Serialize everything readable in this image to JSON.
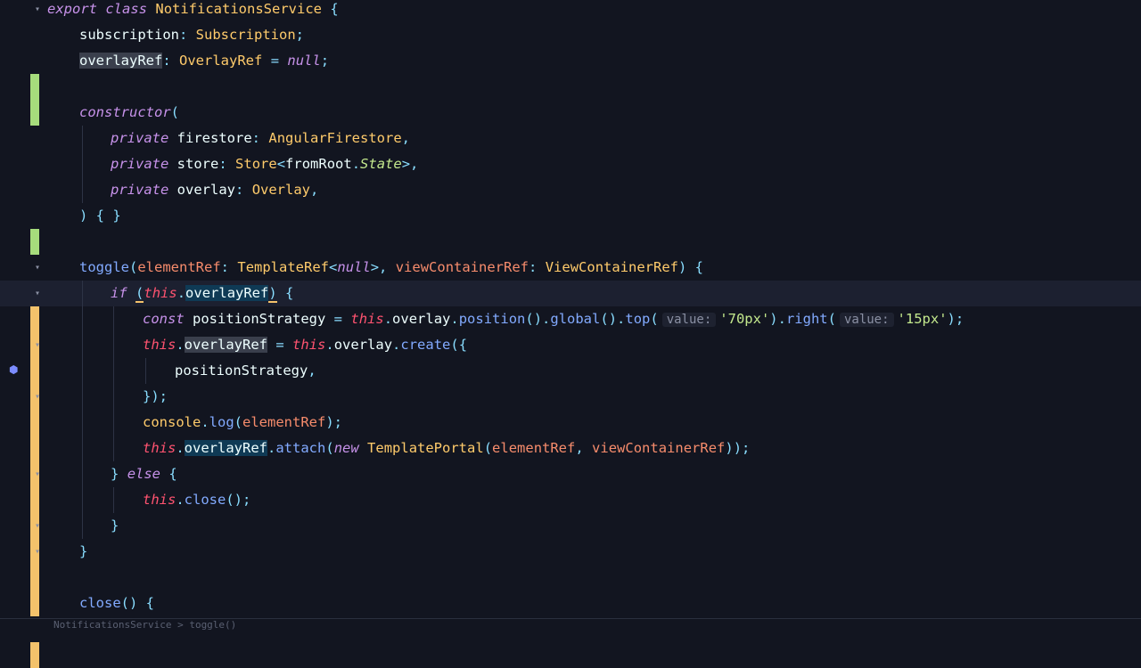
{
  "editor": {
    "lines": [
      {
        "t": "export class NotificationsService {"
      },
      {
        "t": "subscription: Subscription;"
      },
      {
        "t": "overlayRef: OverlayRef = null;"
      },
      {
        "t": ""
      },
      {
        "t": "constructor("
      },
      {
        "t": "private firestore: AngularFirestore,"
      },
      {
        "t": "private store: Store<fromRoot.State>,"
      },
      {
        "t": "private overlay: Overlay,"
      },
      {
        "t": ") { }"
      },
      {
        "t": ""
      },
      {
        "t": "toggle(elementRef: TemplateRef<null>, viewContainerRef: ViewContainerRef) {"
      },
      {
        "t": "if (this.overlayRef) {"
      },
      {
        "t": "const positionStrategy = this.overlay.position().global().top( value: '70px').right( value: '15px');"
      },
      {
        "t": "this.overlayRef = this.overlay.create({"
      },
      {
        "t": "positionStrategy,"
      },
      {
        "t": "});"
      },
      {
        "t": "console.log(elementRef);"
      },
      {
        "t": "this.overlayRef.attach(new TemplatePortal(elementRef, viewContainerRef));"
      },
      {
        "t": "} else {"
      },
      {
        "t": "this.close();"
      },
      {
        "t": "}"
      },
      {
        "t": "}"
      },
      {
        "t": ""
      },
      {
        "t": "close() {"
      }
    ],
    "hint_label": "value:"
  },
  "statusbar": {
    "text": "NotificationsService > toggle()"
  }
}
